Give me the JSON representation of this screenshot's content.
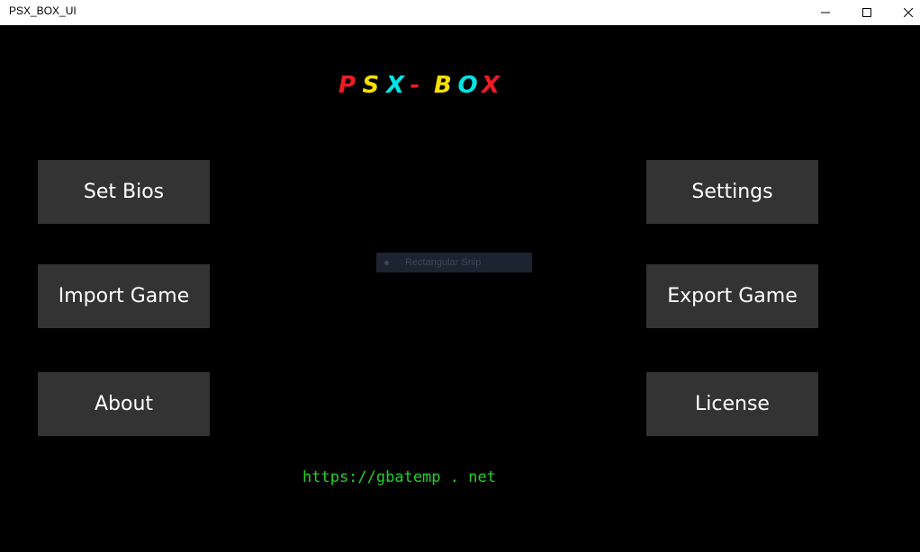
{
  "window": {
    "title": "PSX_BOX_UI",
    "controls": [
      "minimize-icon",
      "maximize-icon",
      "close-icon"
    ]
  },
  "logo": {
    "letters": [
      {
        "char": "P",
        "color": "#ed1c24"
      },
      {
        "char": "S",
        "color": "#f5e000"
      },
      {
        "char": "X",
        "color": "#00e5e5"
      },
      {
        "char": "-",
        "color": "#ed1c24"
      },
      {
        "char": "B",
        "color": "#f5e000"
      },
      {
        "char": "O",
        "color": "#00e5e5"
      },
      {
        "char": "X",
        "color": "#ed1c24"
      }
    ]
  },
  "buttons": {
    "set_bios": "Set Bios",
    "import_game": "Import Game",
    "about": "About",
    "settings": "Settings",
    "export_game": "Export Game",
    "license": "License"
  },
  "snip_overlay": {
    "label": "Rectangular Snip"
  },
  "footer": {
    "link_text": "https://gbatemp . net"
  },
  "colors": {
    "background": "#000000",
    "button_bg": "#333333",
    "button_text": "#ffffff",
    "link": "#22d12c"
  }
}
